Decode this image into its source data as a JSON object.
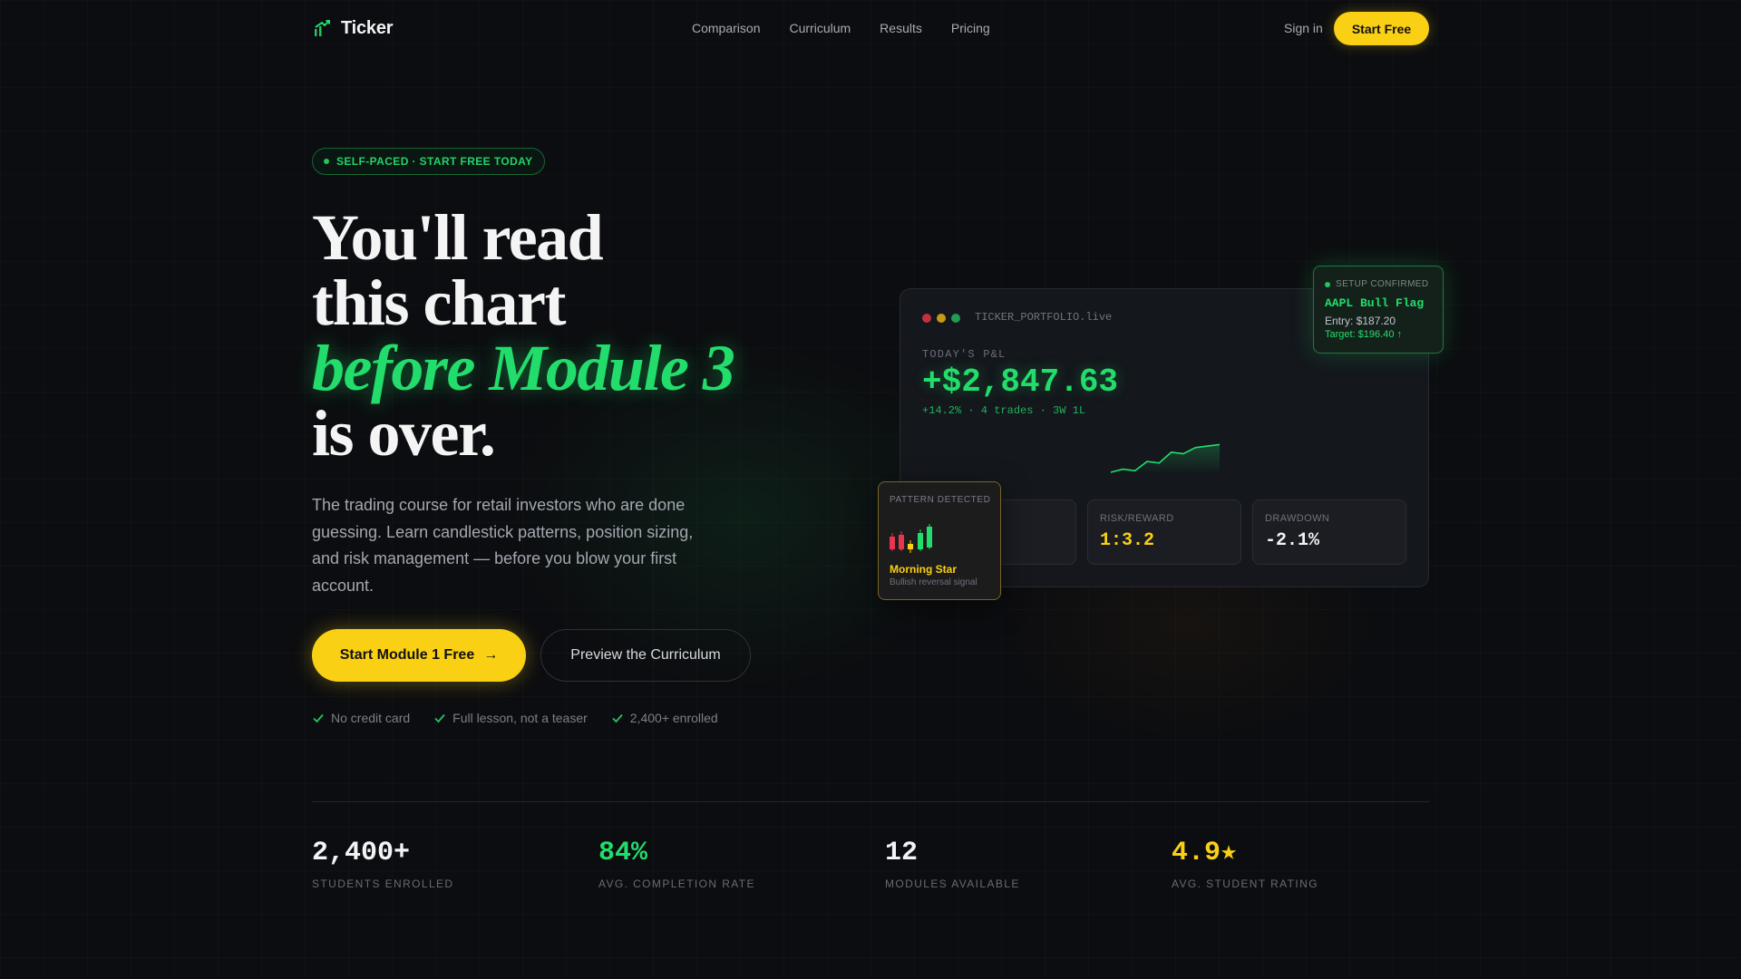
{
  "nav": {
    "brand": "Ticker",
    "links": [
      "Comparison",
      "Curriculum",
      "Results",
      "Pricing"
    ],
    "sign_in": "Sign in",
    "cta": "Start Free"
  },
  "hero": {
    "badge": "SELF-PACED · START FREE TODAY",
    "headline": {
      "line1": "You'll read",
      "line2": "this chart",
      "accent": "before Module 3",
      "line4": "is over."
    },
    "subtext": "The trading course for retail investors who are done guessing. Learn candlestick patterns, position sizing, and risk management — before you blow your first account.",
    "cta_primary": "Start Module 1 Free",
    "cta_primary_arrow": "→",
    "cta_secondary": "Preview the Curriculum",
    "checks": [
      "No credit card",
      "Full lesson, not a teaser",
      "2,400+ enrolled"
    ]
  },
  "dashboard": {
    "window_title": "TICKER_PORTFOLIO.live",
    "pnl_label": "TODAY'S P&L",
    "pnl_value": "+$2,847.63",
    "pnl_sub": "+14.2% · 4 trades · 3W 1L",
    "sparkline_points": [
      4,
      6,
      5,
      11,
      10,
      17,
      16,
      20,
      21,
      22
    ],
    "metrics": [
      {
        "label": "",
        "value": ""
      },
      {
        "label": "RISK/REWARD",
        "value": "1:3.2",
        "color": "#fad014"
      },
      {
        "label": "DRAWDOWN",
        "value": "-2.1%",
        "color": "#f2f3f5"
      }
    ]
  },
  "setup_popup": {
    "label": "SETUP CONFIRMED",
    "title": "AAPL Bull Flag",
    "entry": "Entry: $187.20",
    "target": "Target: $196.40 ↑"
  },
  "pattern_popup": {
    "label": "PATTERN DETECTED",
    "name": "Morning Star",
    "sub": "Bullish reversal signal"
  },
  "stats": [
    {
      "value": "2,400+",
      "label": "STUDENTS ENROLLED",
      "color": "#f2f3f5"
    },
    {
      "value": "84%",
      "label": "AVG. COMPLETION RATE",
      "color": "#22dd6b"
    },
    {
      "value": "12",
      "label": "MODULES AVAILABLE",
      "color": "#f2f3f5"
    },
    {
      "value": "4.9★",
      "label": "AVG. STUDENT RATING",
      "color": "#fad014"
    }
  ],
  "colors": {
    "accent_green": "#22dd6b",
    "accent_yellow": "#fad014",
    "background": "#0c0d10",
    "loss_red": "#e5364f"
  }
}
